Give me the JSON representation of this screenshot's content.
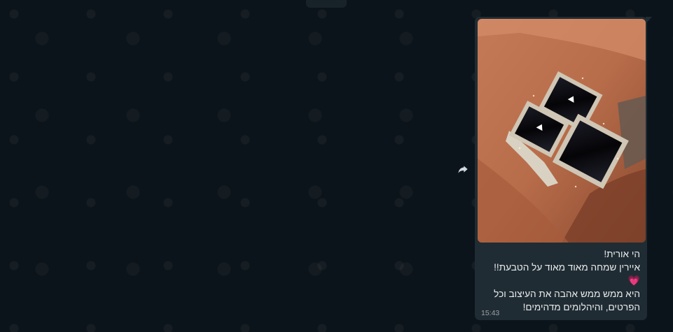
{
  "message": {
    "lines": [
      "הי אורית!",
      "איירין שמחה מאוד מאוד על הטבעת!!",
      "💗",
      "היא ממש ממש אהבה את העיצוב וכל",
      "הפרטים, והיהלומים מדהימים!"
    ],
    "time": "15:43"
  },
  "icons": {
    "forward": "forward-arrow-icon"
  },
  "colors": {
    "background": "#0b141a",
    "bubble": "#202c33",
    "text": "#e9edef",
    "heart": "#f06292"
  }
}
